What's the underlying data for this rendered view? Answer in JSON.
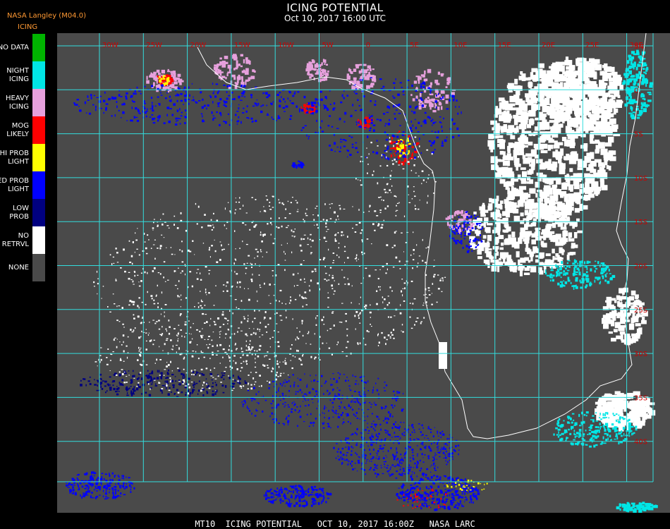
{
  "header": {
    "title": "ICING POTENTIAL",
    "datetime": "Oct 10, 2017 16:00 UTC",
    "source": "NASA Langley (M04.0)",
    "product": "ICING"
  },
  "legend": [
    {
      "label": "NO DATA",
      "color": "#00b400"
    },
    {
      "label": "NIGHT\nICING",
      "color": "#00e6e6"
    },
    {
      "label": "HEAVY\nICING",
      "color": "#e6a0dc"
    },
    {
      "label": "MOG\nLIKELY",
      "color": "#ff0000"
    },
    {
      "label": "HI PROB\nLIGHT",
      "color": "#ffff00"
    },
    {
      "label": "MED PROB\nLIGHT",
      "color": "#0000ff"
    },
    {
      "label": "LOW\nPROB",
      "color": "#000080"
    },
    {
      "label": "NO\nRETRVL",
      "color": "#ffffff"
    },
    {
      "label": "NONE",
      "color": "#4a4a4a"
    }
  ],
  "map": {
    "grid_color": "#33dddd",
    "label_color": "#cc0000",
    "lon_labels": [
      "30W",
      "25W",
      "20W",
      "15W",
      "10W",
      "5W",
      "0",
      "5E",
      "10E",
      "15E",
      "20E",
      "25E",
      "30E",
      "35E"
    ],
    "lat_labels": [
      "5N",
      "0",
      "5S",
      "10S",
      "15S",
      "20S",
      "25S",
      "30S",
      "35S",
      "40S"
    ]
  },
  "footer": "MT10  ICING POTENTIAL   OCT 10, 2017 16:00Z   NASA LARC"
}
